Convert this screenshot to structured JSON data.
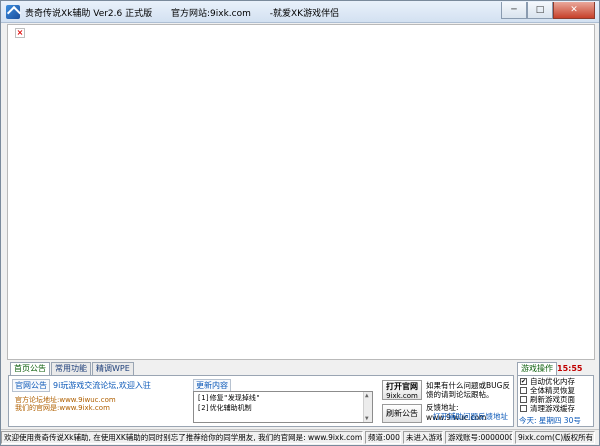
{
  "window": {
    "title_parts": [
      "贵奇传说Xk辅助 Ver2.6 正式版",
      "官方网站:9ixk.com",
      "-就爱XK游戏伴侣"
    ],
    "min_label": "─",
    "max_label": "□",
    "close_label": "✕"
  },
  "browser": {
    "broken_image_glyph": "×"
  },
  "tabs": [
    "首页公告",
    "常用功能",
    "精调WPE"
  ],
  "panel": {
    "section_label": "官网公告",
    "forum_link": "9i玩游戏交流论坛,欢迎入驻",
    "forum_addr": "官方论坛地址:www.9iwuc.com",
    "site_addr": "我们的官网是:www.9ixk.com",
    "update_title": "更新内容",
    "update_lines": [
      "[1]修复\"发现掉线\"",
      "[2]优化辅助机制"
    ],
    "open_site_label_top": "打开官网",
    "open_site_label_bottom": "9ixk.com",
    "refresh_label": "刷新公告",
    "issue_text": "如果有什么问题或BUG反馈的请到论坛跟帖。",
    "feedback_addr": "反馈地址: www.9iwuc.com",
    "feedback_link": "打开辅助问题反馈地址"
  },
  "right": {
    "game_tab": "游戏操作",
    "clock": "15:55",
    "options": [
      {
        "label": "自动优化内存",
        "checked": true
      },
      {
        "label": "全体精灵恢复",
        "checked": false
      },
      {
        "label": "刷新游戏页面",
        "checked": false
      },
      {
        "label": "清理游戏缓存",
        "checked": false
      }
    ],
    "today": "今天: 星期四  30号"
  },
  "status": {
    "welcome": "欢迎使用贵奇传说Xk辅助, 在使用XK辅助的同时别忘了推荐给你的同学朋友, 我们的官网是: www.9ixk.com",
    "frequency": "频道:0000",
    "game_state": "未进入游戏",
    "account": "游戏账号:00000000",
    "copyright": "9ixk.com(C)版权所有"
  }
}
